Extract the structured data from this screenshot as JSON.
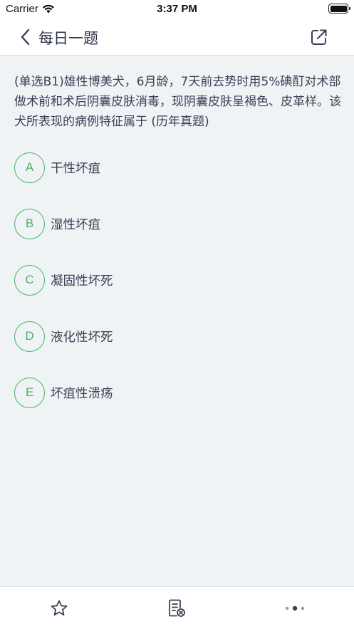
{
  "status_bar": {
    "carrier": "Carrier",
    "time": "3:37 PM"
  },
  "nav": {
    "title": "每日一题"
  },
  "question": {
    "text": "(单选B1)雄性博美犬，6月龄，7天前去势时用5%碘酊对术部做术前和术后阴囊皮肤消毒，现阴囊皮肤呈褐色、皮革样。该犬所表现的病例特征属于 (历年真题)"
  },
  "options": [
    {
      "letter": "A",
      "text": "干性坏疽"
    },
    {
      "letter": "B",
      "text": "湿性坏疽"
    },
    {
      "letter": "C",
      "text": "凝固性坏死"
    },
    {
      "letter": "D",
      "text": "液化性坏死"
    },
    {
      "letter": "E",
      "text": "坏疽性溃疡"
    }
  ],
  "tab_bar": {
    "icons": [
      "star-icon",
      "answer-sheet-icon",
      "more-dots-icon"
    ]
  },
  "colors": {
    "accent": "#4cb35e",
    "text": "#3a3f55",
    "background": "#f0f3f5"
  }
}
